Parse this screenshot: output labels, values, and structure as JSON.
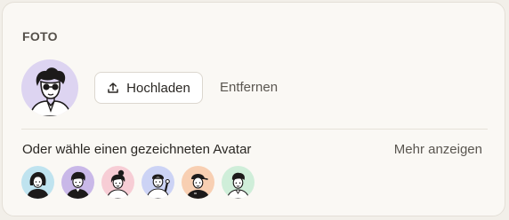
{
  "photo_section": {
    "title": "FOTO",
    "current_avatar_bg": "#ddd4f1",
    "upload_label": "Hochladen",
    "upload_icon": "upload-icon",
    "remove_label": "Entfernen"
  },
  "avatar_picker": {
    "heading": "Oder wähle einen gezeichneten Avatar",
    "more_label": "Mehr anzeigen",
    "options": [
      {
        "name": "avatar-option-1",
        "bg": "#bfe3ef"
      },
      {
        "name": "avatar-option-2",
        "bg": "#c9b8e8"
      },
      {
        "name": "avatar-option-3",
        "bg": "#f7cdd5"
      },
      {
        "name": "avatar-option-4",
        "bg": "#ccd3f5"
      },
      {
        "name": "avatar-option-5",
        "bg": "#f8cfb2"
      },
      {
        "name": "avatar-option-6",
        "bg": "#cfeed9"
      }
    ]
  }
}
